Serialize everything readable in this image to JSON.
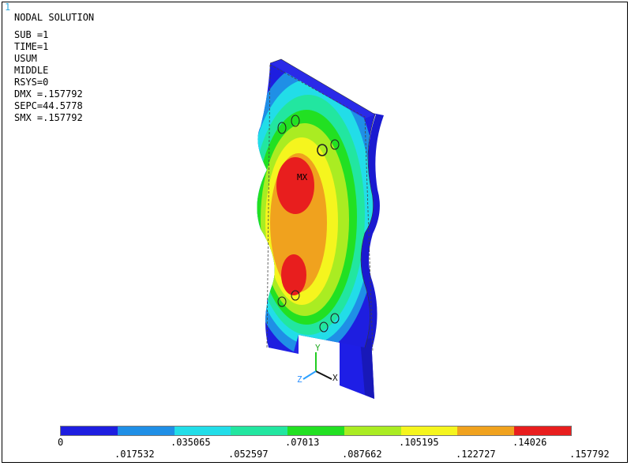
{
  "window_number": "1",
  "info": {
    "title": "NODAL SOLUTION",
    "lines": [
      "SUB =1",
      "TIME=1",
      "USUM",
      "MIDDLE",
      "RSYS=0",
      "DMX =.157792",
      "SEPC=44.5778",
      "SMX =.157792"
    ]
  },
  "labels": {
    "max_marker": "MX",
    "axis_y": "Y",
    "axis_x": "X",
    "axis_z": "Z"
  },
  "legend": {
    "colors": [
      "#1e1ee0",
      "#1f8fe6",
      "#22dde8",
      "#22e6a0",
      "#22e022",
      "#aaec22",
      "#f5f51e",
      "#f0a21e",
      "#e81e1e"
    ],
    "top_labels": [
      "0",
      ".035065",
      ".07013",
      ".105195",
      ".14026"
    ],
    "bottom_labels": [
      ".017532",
      ".052597",
      ".087662",
      ".122727",
      ".157792"
    ]
  }
}
